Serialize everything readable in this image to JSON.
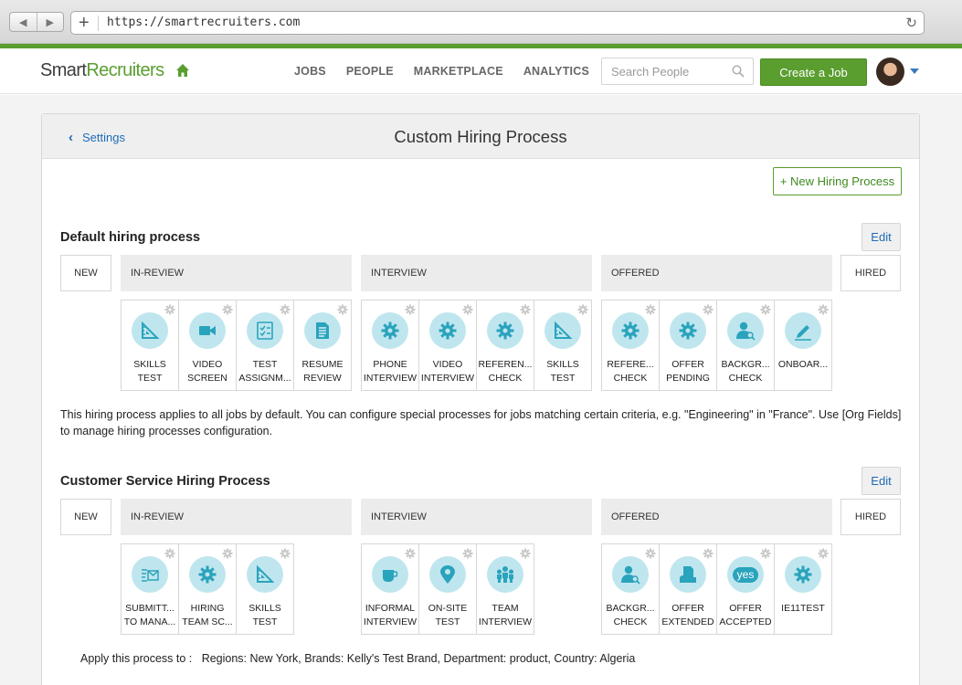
{
  "browser": {
    "url": "https://smartrecruiters.com",
    "back_glyph": "◀",
    "forward_glyph": "▶",
    "plus_glyph": "+",
    "reload_glyph": "↻"
  },
  "header": {
    "logo_part1": "Smart",
    "logo_part2": "Recruiters",
    "nav": [
      "JOBS",
      "PEOPLE",
      "MARKETPLACE",
      "ANALYTICS"
    ],
    "search_placeholder": "Search People",
    "create_label": "Create a Job"
  },
  "page": {
    "back_label": "Settings",
    "title": "Custom Hiring Process",
    "new_process_label": "+ New Hiring Process"
  },
  "processes": [
    {
      "title": "Default hiring process",
      "edit_label": "Edit",
      "stages": {
        "new": "NEW",
        "in_review": "IN-REVIEW",
        "interview": "INTERVIEW",
        "offered": "OFFERED",
        "hired": "HIRED"
      },
      "in_review_steps": [
        {
          "label": "SKILLS\nTEST",
          "icon": "ruler-icon"
        },
        {
          "label": "VIDEO\nSCREEN",
          "icon": "video-camera-icon"
        },
        {
          "label": "TEST\nASSIGNM...",
          "icon": "checklist-icon"
        },
        {
          "label": "RESUME\nREVIEW",
          "icon": "document-icon"
        }
      ],
      "interview_steps": [
        {
          "label": "PHONE\nINTERVIEW",
          "icon": "gear-icon"
        },
        {
          "label": "VIDEO\nINTERVIEW",
          "icon": "gear-icon"
        },
        {
          "label": "REFEREN...\nCHECK",
          "icon": "gear-icon"
        },
        {
          "label": "SKILLS\nTEST",
          "icon": "ruler-icon"
        }
      ],
      "offered_steps": [
        {
          "label": "REFERE...\nCHECK",
          "icon": "gear-icon"
        },
        {
          "label": "OFFER\nPENDING",
          "icon": "gear-icon"
        },
        {
          "label": "BACKGR...\nCHECK",
          "icon": "person-search-icon"
        },
        {
          "label": "ONBOAR...",
          "icon": "pen-icon"
        }
      ],
      "description": "This hiring process applies to all jobs by default. You can configure special processes for jobs matching certain criteria, e.g. \"Engineering\" in \"France\". Use [Org Fields] to manage hiring processes configuration."
    },
    {
      "title": "Customer Service Hiring Process",
      "edit_label": "Edit",
      "stages": {
        "new": "NEW",
        "in_review": "IN-REVIEW",
        "interview": "INTERVIEW",
        "offered": "OFFERED",
        "hired": "HIRED"
      },
      "in_review_steps": [
        {
          "label": "SUBMITT...\nTO MANA...",
          "icon": "send-list-icon"
        },
        {
          "label": "HIRING\nTEAM SC...",
          "icon": "gear-icon"
        },
        {
          "label": "SKILLS\nTEST",
          "icon": "ruler-icon"
        }
      ],
      "interview_steps": [
        {
          "label": "INFORMAL\nINTERVIEW",
          "icon": "coffee-cup-icon"
        },
        {
          "label": "ON-SITE\nTEST",
          "icon": "map-pin-icon"
        },
        {
          "label": "TEAM\nINTERVIEW",
          "icon": "team-icon"
        }
      ],
      "offered_steps": [
        {
          "label": "BACKGR...\nCHECK",
          "icon": "person-search-icon"
        },
        {
          "label": "OFFER\nEXTENDED",
          "icon": "document-hand-icon"
        },
        {
          "label": "OFFER\nACCEPTED",
          "icon": "yes-bubble-icon",
          "icon_text": "yes"
        },
        {
          "label": "IE11TEST",
          "icon": "gear-icon"
        }
      ],
      "apply_text": "Apply this process to :   Regions: New York, Brands: Kelly's Test Brand, Department: product, Country: Algeria"
    }
  ],
  "colors": {
    "brand_green": "#5a9e2f",
    "link_blue": "#1f6bb5",
    "icon_circle": "#bfe6ee",
    "icon_fill": "#2aa3bd"
  }
}
